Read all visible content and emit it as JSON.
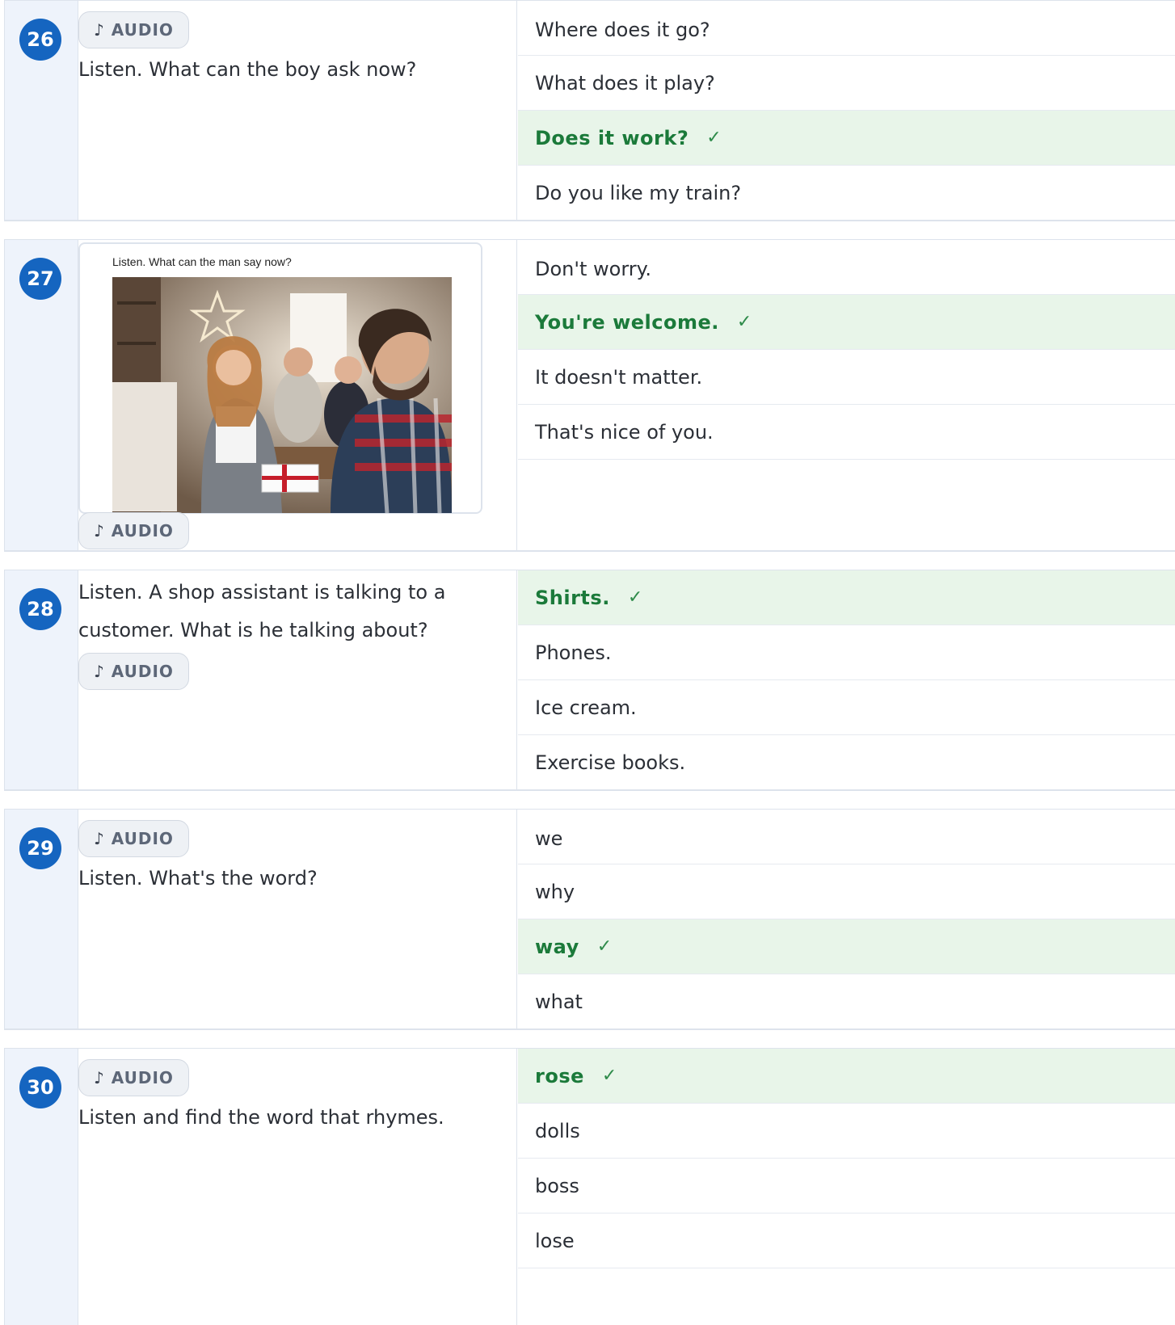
{
  "audio_label": "AUDIO",
  "audio_icon": "music-note-icon",
  "check_mark": "✓",
  "colors": {
    "badge": "#1565c0",
    "correct_bg": "#e8f5e9",
    "correct_text": "#1b7a3a",
    "number_column_bg": "#eef3fb"
  },
  "questions": [
    {
      "number": "26",
      "prompt": "Listen. What can the boy ask now?",
      "options": [
        {
          "text": "Where does it go?",
          "correct": false
        },
        {
          "text": "What does it play?",
          "correct": false
        },
        {
          "text": "Does it work?",
          "correct": true
        },
        {
          "text": "Do you like my train?",
          "correct": false
        }
      ]
    },
    {
      "number": "27",
      "image_caption": "Listen. What can the man say now?",
      "image_description": "photo-gift-exchange",
      "options": [
        {
          "text": "Don't worry.",
          "correct": false
        },
        {
          "text": "You're welcome.",
          "correct": true
        },
        {
          "text": "It doesn't matter.",
          "correct": false
        },
        {
          "text": "That's nice of you.",
          "correct": false
        }
      ]
    },
    {
      "number": "28",
      "prompt": "Listen. A shop assistant is talking to a customer. What is he talking about?",
      "options": [
        {
          "text": "Shirts.",
          "correct": true
        },
        {
          "text": "Phones.",
          "correct": false
        },
        {
          "text": "Ice cream.",
          "correct": false
        },
        {
          "text": "Exercise books.",
          "correct": false
        }
      ]
    },
    {
      "number": "29",
      "prompt": "Listen. What's the word?",
      "options": [
        {
          "text": "we",
          "correct": false
        },
        {
          "text": "why",
          "correct": false
        },
        {
          "text": "way",
          "correct": true
        },
        {
          "text": "what",
          "correct": false
        }
      ]
    },
    {
      "number": "30",
      "prompt": "Listen and find the word that rhymes.",
      "options": [
        {
          "text": "rose",
          "correct": true
        },
        {
          "text": "dolls",
          "correct": false
        },
        {
          "text": "boss",
          "correct": false
        },
        {
          "text": "lose",
          "correct": false
        }
      ]
    }
  ]
}
